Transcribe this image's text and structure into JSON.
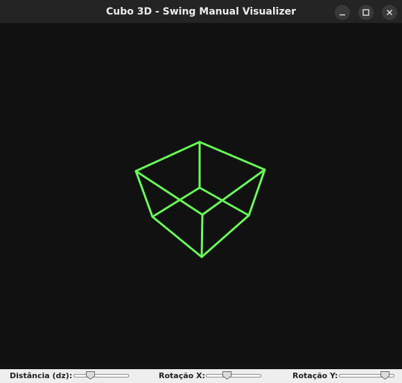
{
  "window": {
    "title": "Cubo 3D - Swing Manual Visualizer",
    "buttons": {
      "minimize": "minimize",
      "maximize": "maximize",
      "close": "close"
    }
  },
  "canvas": {
    "background": "#111111",
    "line_color": "#66ff55"
  },
  "controls": {
    "distance": {
      "label": "Distância (dz):",
      "value": 0.3
    },
    "rotation_x": {
      "label": "Rotação X:",
      "value": 0.38
    },
    "rotation_y": {
      "label": "Rotação Y:",
      "value": 0.82
    }
  }
}
